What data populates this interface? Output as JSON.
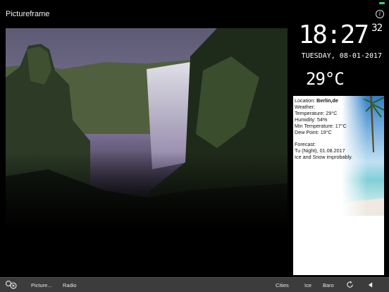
{
  "app": {
    "title": "Pictureframe"
  },
  "clock": {
    "time": "18:27",
    "seconds": "32",
    "date": "TUESDAY, 08-01-2017"
  },
  "current_temp": "29°C",
  "weather": {
    "location_label": "Location: ",
    "location_value": "Berlin,de",
    "weather_label": "Weather:",
    "temperature": "Temperature: 29°C",
    "humidity": "Humidity: 54%",
    "min_temperature": "Min Temperature: 17°C",
    "dew_point": "Dew Point: 19°C",
    "forecast_label": "Forecast:",
    "forecast_time": "Tu (Night), 01.08.2017",
    "forecast_desc": "Ice and Snow improbably."
  },
  "toolbar": {
    "picture_label": "Picture...",
    "radio_label": "Radio",
    "cities_label": "Cities",
    "ice_label": "Ice",
    "baro_label": "Baro"
  },
  "icons": {
    "info": "info-icon",
    "picture_settings": "picture-settings-icon",
    "refresh": "refresh-icon",
    "back": "back-icon"
  },
  "colors": {
    "battery": "#46d160",
    "toolbar_bg": "#3c3c3c",
    "background": "#000000"
  }
}
